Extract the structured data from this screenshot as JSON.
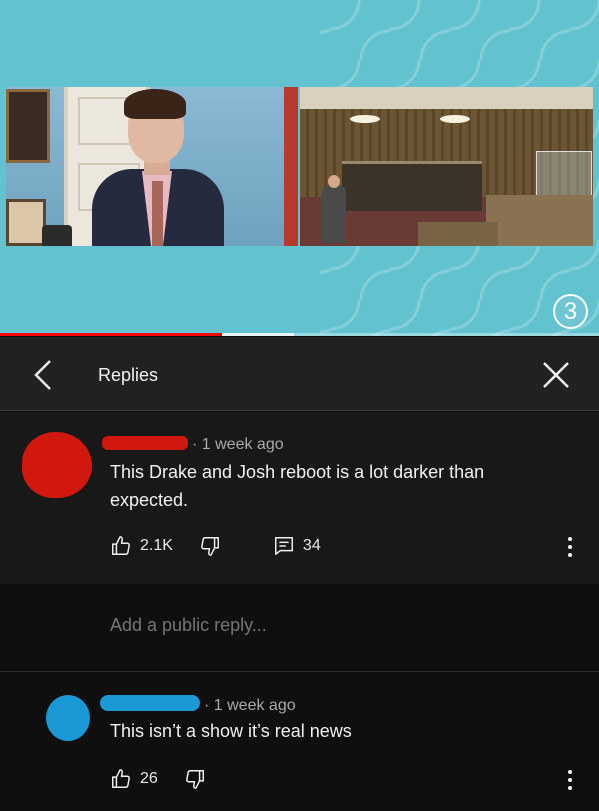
{
  "video": {
    "chapter_number": "3",
    "progress": {
      "played_fraction": 0.37,
      "buffered_fraction": 0.49
    }
  },
  "header": {
    "title": "Replies",
    "back_icon": "chevron-left-icon",
    "close_icon": "close-icon"
  },
  "parent_comment": {
    "time": "1 week ago",
    "text": "This Drake and Josh reboot is a lot darker than expected.",
    "likes": "2.1K",
    "reply_count": "34",
    "avatar_color": "#d0180f"
  },
  "add_reply": {
    "placeholder": "Add a public reply..."
  },
  "reply": {
    "time": "1 week ago",
    "text": "This isn’t a show it’s real news",
    "likes": "26",
    "avatar_color": "#1a99d6"
  },
  "colors": {
    "background": "#0f0f0f",
    "header_bg": "#212121",
    "video_bg": "#63c2cf",
    "progress_red": "#ff0000"
  }
}
